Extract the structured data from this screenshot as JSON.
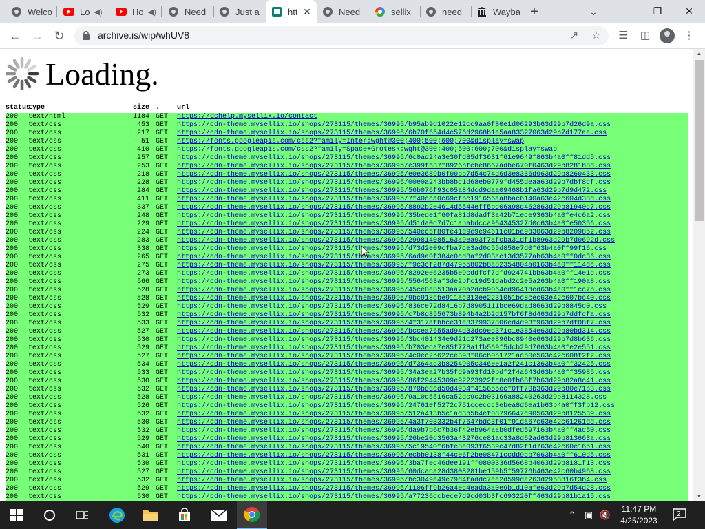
{
  "tabs": [
    {
      "title": "Welco",
      "favicon": "globe-icon",
      "audio": false,
      "active": false
    },
    {
      "title": "Lo",
      "favicon": "youtube-icon",
      "audio": true,
      "active": false
    },
    {
      "title": "Ho",
      "favicon": "youtube-icon",
      "audio": true,
      "active": false
    },
    {
      "title": "Need",
      "favicon": "globe-icon",
      "audio": false,
      "active": false
    },
    {
      "title": "Just a",
      "favicon": "globe-icon",
      "audio": false,
      "active": false
    },
    {
      "title": "htt",
      "favicon": "archive-icon",
      "audio": false,
      "active": true
    },
    {
      "title": "Need",
      "favicon": "globe-icon",
      "audio": false,
      "active": false
    },
    {
      "title": "sellix",
      "favicon": "google-icon",
      "audio": false,
      "active": false
    },
    {
      "title": "need",
      "favicon": "globe-icon",
      "audio": false,
      "active": false
    },
    {
      "title": "Wayba",
      "favicon": "wayback-icon",
      "audio": false,
      "active": false
    }
  ],
  "address_bar": {
    "url": "archive.is/wip/whUV8"
  },
  "page": {
    "heading": "Loading."
  },
  "log": {
    "headers": {
      "status": "status",
      "type": "type",
      "size": "size",
      "method": ".",
      "url": "url"
    },
    "rows": [
      {
        "status": "200",
        "type": "text/html",
        "size": "1184",
        "method": "GET",
        "url": "https://dchelp.mysellix.io/contact"
      },
      {
        "status": "200",
        "type": "text/css",
        "size": "453",
        "method": "GET",
        "url": "https://cdn-theme.mysellix.io/shops/273115/themes/36995/b95ab9d1022e12cc9aa0f80e1d06293b63d29b7d26d9a.css"
      },
      {
        "status": "200",
        "type": "text/css",
        "size": "217",
        "method": "GET",
        "url": "https://cdn-theme.mysellix.io/shops/273115/themes/36995/6b70f654d4e576d2968b1e5aa83327063d29b7d177ae.css"
      },
      {
        "status": "200",
        "type": "text/css",
        "size": "51",
        "method": "GET",
        "url": "https://fonts.googleapis.com/css2?family=Inter:wght@300;400;500;600;700&display=swap"
      },
      {
        "status": "200",
        "type": "text/css",
        "size": "410",
        "method": "GET",
        "url": "https://fonts.googleapis.com/css2?family=Space+Grotesk:wght@300;400;500;600;700&display=swap"
      },
      {
        "status": "200",
        "type": "text/css",
        "size": "257",
        "method": "GET",
        "url": "https://cdn-theme.mysellix.io/shops/273115/themes/36995/6c0ad24a3e30fd85df3631f61e9649f863b4a0ff81dd5.css"
      },
      {
        "status": "200",
        "type": "text/css",
        "size": "253",
        "method": "GET",
        "url": "https://cdn-theme.mysellix.io/shops/273115/themes/36995/e399f637f8926bfcbe8667adbe670f0463d29b8281b8d.css"
      },
      {
        "status": "200",
        "type": "text/css",
        "size": "218",
        "method": "GET",
        "url": "https://cdn-theme.mysellix.io/shops/273115/themes/36995/e0e3689b0f00bb7d54c74d6d3e8336d963d29b8260433.css"
      },
      {
        "status": "200",
        "type": "text/css",
        "size": "228",
        "method": "GET",
        "url": "https://cdn-theme.mysellix.io/shops/273115/themes/36995/00e0a243bb8bc1d68eb0779fd455deaa63d29b7dbf8cf.css"
      },
      {
        "status": "200",
        "type": "text/css",
        "size": "284",
        "method": "GET",
        "url": "https://cdn-theme.mysellix.io/shops/273115/themes/36995/56b076f93c05a84dcd9daa09468b1fa63d29b7d9d472.css"
      },
      {
        "status": "200",
        "type": "text/css",
        "size": "411",
        "method": "GET",
        "url": "https://cdn-theme.mysellix.io/shops/273115/themes/36995/7f40cca0c69cfbc191656aa8bac6140a63e42c604d38d.css"
      },
      {
        "status": "200",
        "type": "text/css",
        "size": "337",
        "method": "GET",
        "url": "https://cdn-theme.mysellix.io/shops/273115/themes/36995/8892b2e4614d5544eff5bc06a98c462863d29b81940c7.css"
      },
      {
        "status": "200",
        "type": "text/css",
        "size": "248",
        "method": "GET",
        "url": "https://cdn-theme.mysellix.io/shops/273115/themes/36995/35bede1f60fa81d8dadf3a42b71ece9363b4a0fe4c6a2.css"
      },
      {
        "status": "200",
        "type": "text/css",
        "size": "229",
        "method": "GET",
        "url": "https://cdn-theme.mysellix.io/shops/273115/themes/36995/d51da0d7d7c1ababdcca964345327d0c63b4a0fe50356.css"
      },
      {
        "status": "200",
        "type": "text/css",
        "size": "224",
        "method": "GET",
        "url": "https://cdn-theme.mysellix.io/shops/273115/themes/36995/540ecbf80fe41d9e9e94611c01ba9d3063d29b8209852.css"
      },
      {
        "status": "200",
        "type": "text/css",
        "size": "283",
        "method": "GET",
        "url": "https://cdn-theme.mysellix.io/shops/273115/themes/36995/299814085163a9ea93f7afcba31df1b8963d29b7d0692d.css"
      },
      {
        "status": "200",
        "type": "text/css",
        "size": "338",
        "method": "GET",
        "url": "https://cdn-theme.mysellix.io/shops/273115/themes/36995/d73d2e09cfba7ce3ad0c55d858e7d0f63b4a0ff99f16.css"
      },
      {
        "status": "200",
        "type": "text/css",
        "size": "265",
        "method": "GET",
        "url": "https://cdn-theme.mysellix.io/shops/273115/themes/36995/6ad9a0f384e0cd8af2d03ac13d3577ab63b4a0ff0dc36.css"
      },
      {
        "status": "200",
        "type": "text/css",
        "size": "275",
        "method": "GET",
        "url": "https://cdn-theme.mysellix.io/shops/273115/themes/36995/f9c3cf287d47955802b8a82354804a0163b4a0ff114dc.css"
      },
      {
        "status": "200",
        "type": "text/css",
        "size": "273",
        "method": "GET",
        "url": "https://cdn-theme.mysellix.io/shops/273115/themes/36995/8292ee6235b5e9cddfcf7dfd924741bb63b4a0ff14e1c.css"
      },
      {
        "status": "200",
        "type": "text/css",
        "size": "566",
        "method": "GET",
        "url": "https://cdn-theme.mysellix.io/shops/273115/themes/36995/5564563af3de2bfc19d51dabd2c2e5a263b4a0ff190a8.css"
      },
      {
        "status": "200",
        "type": "text/css",
        "size": "528",
        "method": "GET",
        "url": "https://cdn-theme.mysellix.io/shops/273115/themes/36995/45ce0e8513aa70a2dcb9064ed9641ded63b4a0ff1cc7b.css"
      },
      {
        "status": "200",
        "type": "text/css",
        "size": "528",
        "method": "GET",
        "url": "https://cdn-theme.mysellix.io/shops/273115/themes/36995/9bc918cbe911ac313ee2231051bc8cec63e42c607bc40.css"
      },
      {
        "status": "200",
        "type": "text/css",
        "size": "529",
        "method": "GET",
        "url": "https://cdn-theme.mysellix.io/shops/273115/themes/36995/836ce72d8416b7d8905111bce69dad8663d29b8845c0.css"
      },
      {
        "status": "200",
        "type": "text/css",
        "size": "532",
        "method": "GET",
        "url": "https://cdn-theme.mysellix.io/shops/273115/themes/36995/c7b8d855673b894b4a2b2d157bf6f8d463d29b7ddfcfa.css"
      },
      {
        "status": "200",
        "type": "text/css",
        "size": "533",
        "method": "GET",
        "url": "https://cdn-theme.mysellix.io/shops/273115/themes/36995/4f317afbbce31e8379937806ed4d93f963d29b7df08f7.css"
      },
      {
        "status": "200",
        "type": "text/css",
        "size": "527",
        "method": "GET",
        "url": "https://cdn-theme.mysellix.io/shops/273115/themes/36995/bccea7655ad94d33dc9ec371c1e3854e63d29b80bd314.css"
      },
      {
        "status": "200",
        "type": "text/css",
        "size": "530",
        "method": "GET",
        "url": "https://cdn-theme.mysellix.io/shops/273115/themes/36995/3bc401434e9d21c273aee896bc8940e663d29b7d8b636.css"
      },
      {
        "status": "200",
        "type": "text/css",
        "size": "529",
        "method": "GET",
        "url": "https://cdn-theme.mysellix.io/shops/273115/themes/36995/b703eca7e85f778a1fb569f5dcb29d7663b4a0fe2e551.css"
      },
      {
        "status": "200",
        "type": "text/css",
        "size": "527",
        "method": "GET",
        "url": "https://cdn-theme.mysellix.io/shops/273115/themes/36995/4c0ec25622ce398f06cb0b1721acb0e563e42c608f2f2.css"
      },
      {
        "status": "200",
        "type": "text/css",
        "size": "534",
        "method": "GET",
        "url": "https://cdn-theme.mysellix.io/shops/273115/themes/36995/d7364ac3b8254905c346ee1a2f241c1363b4a0ff32425.css"
      },
      {
        "status": "200",
        "type": "text/css",
        "size": "533",
        "method": "GET",
        "url": "https://cdn-theme.mysellix.io/shops/273115/themes/36995/34a3ea27b35fd9a93fd10bdf2f4a643d63b4a0ff35985.css"
      },
      {
        "status": "200",
        "type": "text/css",
        "size": "530",
        "method": "GET",
        "url": "https://cdn-theme.mysellix.io/shops/273115/themes/36995/86f29445309e92223922fc8e0fb68f7b63d29b82a8c41.css"
      },
      {
        "status": "200",
        "type": "text/css",
        "size": "532",
        "method": "GET",
        "url": "https://cdn-theme.mysellix.io/shops/273115/themes/36995/870bddcd50d4934f415655ecf0ff70b363d29b80e71b3.css"
      },
      {
        "status": "200",
        "type": "text/css",
        "size": "528",
        "method": "GET",
        "url": "https://cdn-theme.mysellix.io/shops/273115/themes/36995/9a10c5516ca52dc9c2b03166a88240263d29b8114328.css"
      },
      {
        "status": "200",
        "type": "text/css",
        "size": "526",
        "method": "GET",
        "url": "https://cdn-theme.mysellix.io/shops/273115/themes/36995/24761ef5272c751cceccc3ebea8d6ea1b63b4a0ff3fb12.css"
      },
      {
        "status": "200",
        "type": "text/css",
        "size": "532",
        "method": "GET",
        "url": "https://cdn-theme.mysellix.io/shops/273115/themes/36995/512a413b5c1ad3b5b4ef08796647c90563d29b8125539.css"
      },
      {
        "status": "200",
        "type": "text/css",
        "size": "530",
        "method": "GET",
        "url": "https://cdn-theme.mysellix.io/shops/273115/themes/36995/4a3f703332b4f7647bdc3f01f91da67c63e42c61261dd.css"
      },
      {
        "status": "200",
        "type": "text/css",
        "size": "532",
        "method": "GET",
        "url": "https://cdn-theme.mysellix.io/shops/273115/themes/36995/da9b7b6c7b36f42eb964aab0dfed597163b4a0ff4ac50.css"
      },
      {
        "status": "200",
        "type": "text/css",
        "size": "529",
        "method": "GET",
        "url": "https://cdn-theme.mysellix.io/shops/273115/themes/36995/26be20d3563a43276ce81ac33a8d62ad63d29b813663a.css"
      },
      {
        "status": "200",
        "type": "text/css",
        "size": "540",
        "method": "GET",
        "url": "https://cdn-theme.mysellix.io/shops/273115/themes/36995/5c19540f6bfe8e093f6539c47d82f1d763e42c60e1651.css"
      },
      {
        "status": "200",
        "type": "text/css",
        "size": "531",
        "method": "GET",
        "url": "https://cdn-theme.mysellix.io/shops/273115/themes/36995/ecbb0138f44ce6f2be08471ccdd9cb7063b4a0ff610d5.css"
      },
      {
        "status": "200",
        "type": "text/css",
        "size": "530",
        "method": "GET",
        "url": "https://cdn-theme.mysellix.io/shops/273115/themes/36995/3ba7fec46dee191ff0800336d5668b4063d29b8181f13.css"
      },
      {
        "status": "200",
        "type": "text/css",
        "size": "527",
        "method": "GET",
        "url": "https://cdn-theme.mysellix.io/shops/273115/themes/36995/60dcaca28d3808281be159b5f59776b463e42c60b4968.css"
      },
      {
        "status": "200",
        "type": "text/css",
        "size": "532",
        "method": "GET",
        "url": "https://cdn-theme.mysellix.io/shops/273115/themes/36995/bc3049a49e79d4faddc7ee2d599da263d29b8816f3b4.css"
      },
      {
        "status": "200",
        "type": "text/css",
        "size": "529",
        "method": "GET",
        "url": "https://cdn-theme.mysellix.io/shops/273115/themes/36995/1106ff9b26a4ec4eada3a0e9b1d10afe63d29b7d54d28.css"
      },
      {
        "status": "200",
        "type": "text/css",
        "size": "530",
        "method": "GET",
        "url": "https://cdn-theme.mysellix.io/shops/273115/themes/36995/a77236ccbece7d9cd03b3fc693220ff463d29b81b1a15.css"
      }
    ]
  },
  "taskbar": {
    "apps": [
      {
        "name": "start-button"
      },
      {
        "name": "search-button"
      },
      {
        "name": "task-view-button"
      },
      {
        "name": "edge-app"
      },
      {
        "name": "file-explorer-app"
      },
      {
        "name": "store-app"
      },
      {
        "name": "mail-app"
      },
      {
        "name": "chrome-app"
      }
    ],
    "time": "11:47 PM",
    "date": "4/25/2023",
    "notification_count": "2"
  },
  "colors": {
    "log_row_bg": "#77ff77",
    "link": "#0000cc",
    "accent": "#76b9ed"
  }
}
